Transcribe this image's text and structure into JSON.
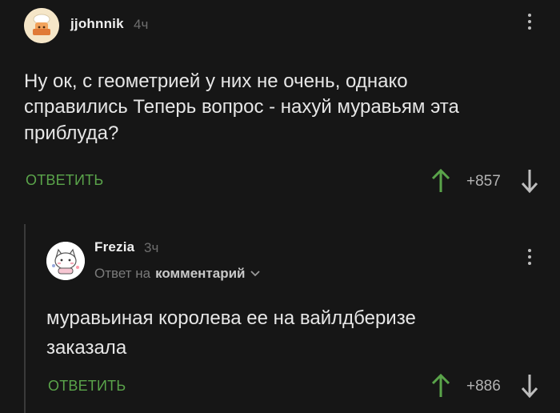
{
  "comments": [
    {
      "username": "jjohnnik",
      "time": "4ч",
      "text": "Ну ок, с геометрией у них не очень, однако справились Теперь вопрос - нахуй муравьям эта приблуда?",
      "reply_label": "ОТВЕТИТЬ",
      "score": "+857",
      "colors": {
        "accent": "#5aa44a",
        "avatar_bg": "#f5e6c8"
      },
      "icons": {
        "avatar": "chef-cartoon-avatar",
        "menu": "kebab-menu-icon",
        "up": "arrow-up-icon",
        "down": "arrow-down-icon"
      }
    },
    {
      "username": "Frezia",
      "time": "3ч",
      "reply_to_prefix": "Ответ на",
      "reply_to_link": "комментарий",
      "text": "муравьиная королева ее на вайлдберизе заказала",
      "reply_label": "ОТВЕТИТЬ",
      "score": "+886",
      "colors": {
        "accent": "#5aa44a",
        "avatar_bg": "#ffffff"
      },
      "icons": {
        "avatar": "cat-sticker-avatar",
        "menu": "kebab-menu-icon",
        "up": "arrow-up-icon",
        "down": "arrow-down-icon",
        "reply_to": "chevron-down-icon"
      }
    }
  ]
}
